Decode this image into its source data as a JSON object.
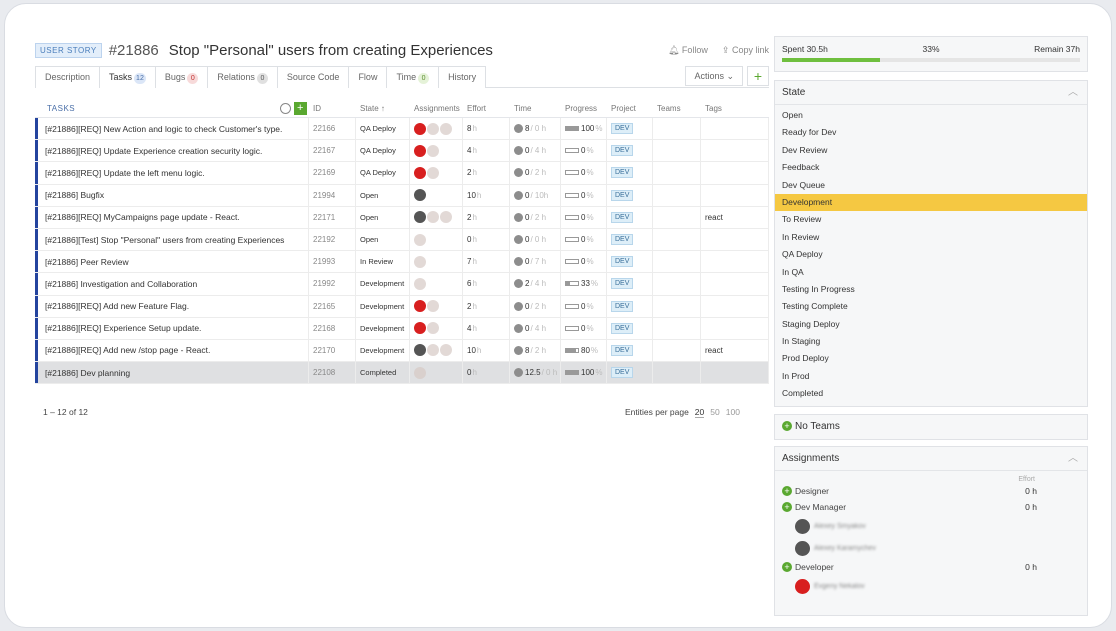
{
  "header": {
    "type_badge": "USER STORY",
    "story_id": "#21886",
    "title": "Stop \"Personal\" users from creating Experiences",
    "follow": "Follow",
    "copy_link": "Copy link"
  },
  "tabs": [
    {
      "label": "Description"
    },
    {
      "label": "Tasks",
      "count": "12",
      "count_style": "blue"
    },
    {
      "label": "Bugs",
      "count": "0",
      "count_style": "red"
    },
    {
      "label": "Relations",
      "count": "0",
      "count_style": "grey"
    },
    {
      "label": "Source Code"
    },
    {
      "label": "Flow"
    },
    {
      "label": "Time",
      "count": "0",
      "count_style": "green"
    },
    {
      "label": "History"
    }
  ],
  "toolbar": {
    "actions_label": "Actions ⌄",
    "add_label": "+"
  },
  "table": {
    "columns": {
      "tasks": "TASKS",
      "id": "ID",
      "state": "State ↑",
      "assignments": "Assignments",
      "effort": "Effort",
      "time": "Time",
      "progress": "Progress",
      "project": "Project",
      "teams": "Teams",
      "tags": "Tags"
    },
    "rows": [
      {
        "name": "[#21886][REQ] New Action and logic to check Customer's type.",
        "id": "22166",
        "state": "QA Deploy",
        "avatars": [
          "red",
          "grey",
          "grey"
        ],
        "effort": "8",
        "time_spent": "8",
        "time_remain": "/ 0 h",
        "progress": "100",
        "project": "DEV",
        "tags": ""
      },
      {
        "name": "[#21886][REQ] Update Experience creation security logic.",
        "id": "22167",
        "state": "QA Deploy",
        "avatars": [
          "red",
          "grey"
        ],
        "effort": "4",
        "time_spent": "0",
        "time_remain": "/ 4 h",
        "progress": "0",
        "project": "DEV",
        "tags": ""
      },
      {
        "name": "[#21886][REQ] Update the left menu logic.",
        "id": "22169",
        "state": "QA Deploy",
        "avatars": [
          "red",
          "grey"
        ],
        "effort": "2",
        "time_spent": "0",
        "time_remain": "/ 2 h",
        "progress": "0",
        "project": "DEV",
        "tags": ""
      },
      {
        "name": "[#21886] Bugfix",
        "id": "21994",
        "state": "Open",
        "avatars": [
          "dark"
        ],
        "effort": "10",
        "time_spent": "0",
        "time_remain": "/ 10h",
        "progress": "0",
        "project": "DEV",
        "tags": ""
      },
      {
        "name": "[#21886][REQ] MyCampaigns page update - React.",
        "id": "22171",
        "state": "Open",
        "avatars": [
          "dark",
          "grey",
          "grey"
        ],
        "effort": "2",
        "time_spent": "0",
        "time_remain": "/ 2 h",
        "progress": "0",
        "project": "DEV",
        "tags": "react"
      },
      {
        "name": "[#21886][Test] Stop \"Personal\" users from creating Experiences",
        "id": "22192",
        "state": "Open",
        "avatars": [
          "grey"
        ],
        "effort": "0",
        "time_spent": "0",
        "time_remain": "/ 0 h",
        "progress": "0",
        "project": "DEV",
        "tags": ""
      },
      {
        "name": "[#21886] Peer Review",
        "id": "21993",
        "state": "In Review",
        "avatars": [
          "grey"
        ],
        "effort": "7",
        "time_spent": "0",
        "time_remain": "/ 7 h",
        "progress": "0",
        "project": "DEV",
        "tags": ""
      },
      {
        "name": "[#21886] Investigation and Collaboration",
        "id": "21992",
        "state": "Development",
        "avatars": [
          "grey"
        ],
        "effort": "6",
        "time_spent": "2",
        "time_remain": "/ 4 h",
        "progress": "33",
        "project": "DEV",
        "tags": ""
      },
      {
        "name": "[#21886][REQ] Add new Feature Flag.",
        "id": "22165",
        "state": "Development",
        "avatars": [
          "red",
          "grey"
        ],
        "effort": "2",
        "time_spent": "0",
        "time_remain": "/ 2 h",
        "progress": "0",
        "project": "DEV",
        "tags": ""
      },
      {
        "name": "[#21886][REQ] Experience Setup update.",
        "id": "22168",
        "state": "Development",
        "avatars": [
          "red",
          "grey"
        ],
        "effort": "4",
        "time_spent": "0",
        "time_remain": "/ 4 h",
        "progress": "0",
        "project": "DEV",
        "tags": ""
      },
      {
        "name": "[#21886][REQ] Add new /stop page - React.",
        "id": "22170",
        "state": "Development",
        "avatars": [
          "dark",
          "grey",
          "grey"
        ],
        "effort": "10",
        "time_spent": "8",
        "time_remain": "/ 2 h",
        "progress": "80",
        "project": "DEV",
        "tags": "react"
      },
      {
        "name": "[#21886] Dev planning",
        "id": "22108",
        "state": "Completed",
        "avatars": [
          "grey"
        ],
        "effort": "0",
        "time_spent": "12.5",
        "time_remain": "/ 0 h",
        "progress": "100",
        "project": "DEV",
        "tags": "",
        "selected": true
      }
    ]
  },
  "pager": {
    "range": "1 – 12 of 12",
    "per_page_label": "Entities per page",
    "options": [
      "20",
      "50",
      "100"
    ],
    "selected": "20"
  },
  "spent": {
    "spent": "Spent 30.5h",
    "percent": "33%",
    "remain": "Remain 37h",
    "fraction": 0.33
  },
  "state_panel": {
    "title": "State",
    "items": [
      "Open",
      "Ready for Dev",
      "Dev Review",
      "Feedback",
      "Dev Queue",
      "Development",
      "To Review",
      "In Review",
      "QA Deploy",
      "In QA",
      "Testing In Progress",
      "Testing Complete",
      "Staging Deploy",
      "In Staging",
      "Prod Deploy",
      "In Prod",
      "Completed"
    ],
    "selected": "Development"
  },
  "teams_panel": {
    "title": "No Teams"
  },
  "assignments_panel": {
    "title": "Assignments",
    "effort_label": "Effort",
    "roles": [
      {
        "role": "Designer",
        "hours": "0 h",
        "people": []
      },
      {
        "role": "Dev Manager",
        "hours": "0 h",
        "people": [
          {
            "name": "Alexey Smyakov",
            "avatar": "dark"
          },
          {
            "name": "Alexey Karamychev",
            "avatar": "dark"
          }
        ]
      },
      {
        "role": "Developer",
        "hours": "0 h",
        "people": [
          {
            "name": "Evgeny Nekalov",
            "avatar": "red"
          }
        ]
      }
    ]
  },
  "colors": {
    "accent_green": "#5aa830",
    "selected_state": "#f5c842",
    "row_marker": "#24449e"
  }
}
